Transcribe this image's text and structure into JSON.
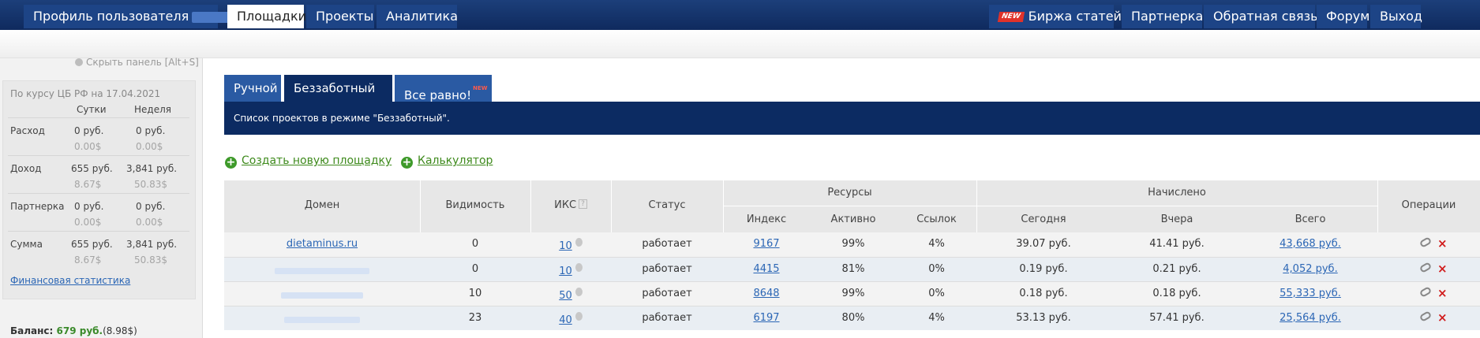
{
  "topnav": {
    "profile_label": "Профиль пользователя",
    "tabs": [
      "Площадки",
      "Проекты",
      "Аналитика"
    ],
    "right_items": {
      "new_badge": "NEW",
      "articles": "Биржа статей",
      "partners": "Партнерка",
      "feedback": "Обратная связь",
      "forum": "Форум",
      "logout": "Выход"
    }
  },
  "sidebar": {
    "hide_panel": "Скрыть панель [Alt+S]",
    "rate_note": "По курсу ЦБ РФ на 17.04.2021",
    "col_day": "Сутки",
    "col_week": "Неделя",
    "rows": [
      {
        "label": "Расход",
        "day": "0 руб.",
        "day_usd": "0.00$",
        "week": "0 руб.",
        "week_usd": "0.00$"
      },
      {
        "label": "Доход",
        "day": "655 руб.",
        "day_usd": "8.67$",
        "week": "3,841 руб.",
        "week_usd": "50.83$"
      },
      {
        "label": "Партнерка",
        "day": "0 руб.",
        "day_usd": "0.00$",
        "week": "0 руб.",
        "week_usd": "0.00$"
      },
      {
        "label": "Сумма",
        "day": "655 руб.",
        "day_usd": "8.67$",
        "week": "3,841 руб.",
        "week_usd": "50.83$"
      }
    ],
    "fin_stats_link": "Финансовая статистика",
    "balance_label": "Баланс:",
    "balance_value": "679 руб.",
    "balance_usd": "(8.98$)"
  },
  "mode_tabs": {
    "manual": "Ручной",
    "carefree": "Беззаботный",
    "whatever": "Все равно!",
    "whatever_badge": "NEW"
  },
  "banner": "Список проектов в режиме \"Беззаботный\".",
  "actions": {
    "create": "Создать новую площадку",
    "calculator": "Калькулятор"
  },
  "table": {
    "headers": {
      "domain": "Домен",
      "visibility": "Видимость",
      "iks": "ИКС",
      "iks_help": "?",
      "status": "Статус",
      "resources": "Ресурсы",
      "index": "Индекс",
      "active": "Активно",
      "links": "Ссылок",
      "accrued": "Начислено",
      "today": "Сегодня",
      "yesterday": "Вчера",
      "total": "Всего",
      "operations": "Операции"
    },
    "rows": [
      {
        "domain": "dietaminus.ru",
        "visibility": "0",
        "iks": "10",
        "status": "работает",
        "index": "9167",
        "active": "99%",
        "links": "4%",
        "today": "39.07 руб.",
        "yesterday": "41.41 руб.",
        "total": "43,668 руб."
      },
      {
        "domain": "",
        "visibility": "0",
        "iks": "10",
        "status": "работает",
        "index": "4415",
        "active": "81%",
        "links": "0%",
        "today": "0.19 руб.",
        "yesterday": "0.21 руб.",
        "total": "4,052 руб."
      },
      {
        "domain": "",
        "visibility": "10",
        "iks": "50",
        "status": "работает",
        "index": "8648",
        "active": "99%",
        "links": "0%",
        "today": "0.18 руб.",
        "yesterday": "0.18 руб.",
        "total": "55,333 руб."
      },
      {
        "domain": "",
        "visibility": "23",
        "iks": "40",
        "status": "работает",
        "index": "6197",
        "active": "80%",
        "links": "4%",
        "today": "53.13 руб.",
        "yesterday": "57.41 руб.",
        "total": "25,564 руб."
      }
    ]
  },
  "colors": {
    "nav_bg": "#0f2a5e",
    "tab_blue": "#2a5aa3",
    "banner_navy": "#0c2b62",
    "link_blue": "#2b66b5",
    "action_green": "#3e8a1c",
    "delete_red": "#d11c1c"
  }
}
